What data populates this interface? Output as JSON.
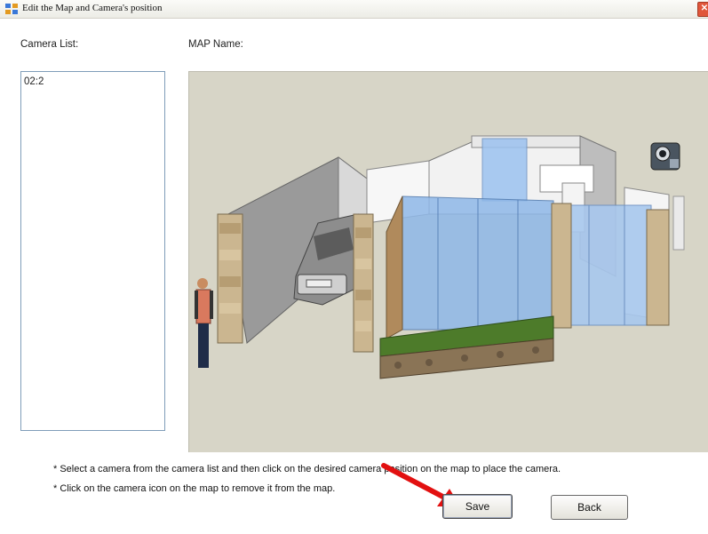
{
  "window": {
    "title": "Edit the Map and Camera's position",
    "close_glyph": "✕"
  },
  "camera_list": {
    "label": "Camera List:",
    "items": [
      "02:2"
    ]
  },
  "map": {
    "label": "MAP Name:",
    "camera_icon": "webcam-icon"
  },
  "instructions": [
    "* Select a camera from the camera list and then click on the desired camera position on the map to place the camera.",
    "* Click on the camera icon on the map to remove it from the map."
  ],
  "buttons": {
    "save": "Save",
    "back": "Back"
  },
  "colors": {
    "arrow": "#e21010",
    "map_bg": "#d7d5c7",
    "glass": "#8fb8e8",
    "lawn": "#4d7b2a"
  }
}
